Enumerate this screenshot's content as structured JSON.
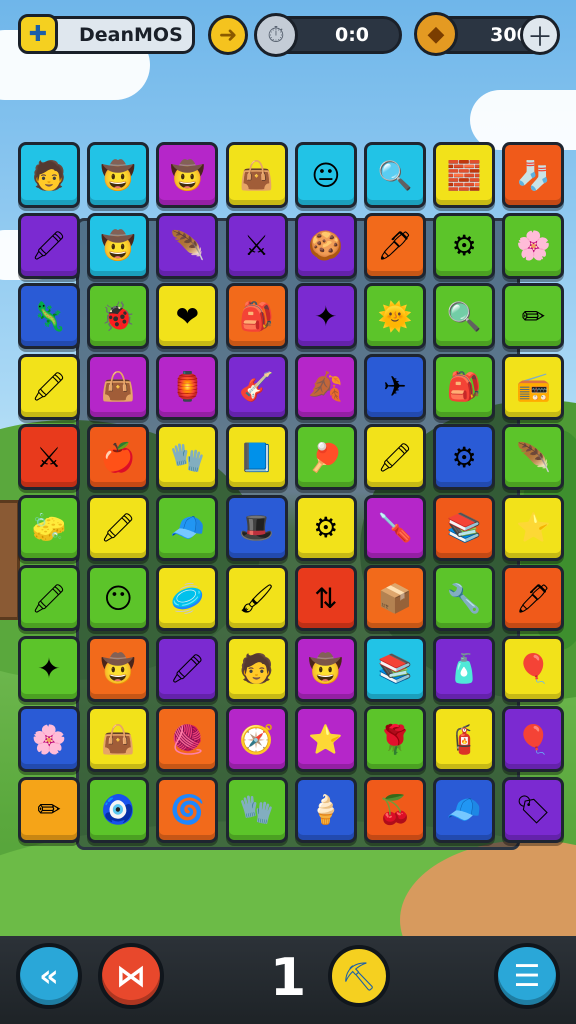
{
  "topbar": {
    "player_name": "DeanMOS",
    "timer": "0:0",
    "coins": "300",
    "name_icon": "puzzle-icon",
    "timer_lead_icon": "arrow-icon",
    "timer_icon": "stopwatch-icon",
    "coin_icon": "coin-icon",
    "plus_icon": "plus-icon"
  },
  "board": {
    "columns": 8,
    "rows": 10,
    "tiles": [
      [
        {
          "c": "#22c3e6",
          "i": "🧑"
        },
        {
          "c": "#22c3e6",
          "i": "🤠"
        },
        {
          "c": "#b526c9",
          "i": "🤠"
        },
        {
          "c": "#f2e21a",
          "i": "👜"
        },
        {
          "c": "#22c3e6",
          "i": "😐"
        },
        {
          "c": "#22c3e6",
          "i": "🔍"
        },
        {
          "c": "#f2e21a",
          "i": "🧱"
        },
        {
          "c": "#f05a1a",
          "i": "🧦"
        }
      ],
      [
        {
          "c": "#7b2ad1",
          "i": "🖍"
        },
        {
          "c": "#22c3e6",
          "i": "🤠"
        },
        {
          "c": "#7b2ad1",
          "i": "🪶"
        },
        {
          "c": "#7b2ad1",
          "i": "⚔"
        },
        {
          "c": "#7b2ad1",
          "i": "🍪"
        },
        {
          "c": "#f26a1b",
          "i": "🖊"
        },
        {
          "c": "#5cc42a",
          "i": "⚙"
        },
        {
          "c": "#5cc42a",
          "i": "🌸"
        }
      ],
      [
        {
          "c": "#2a5bd6",
          "i": "🦎"
        },
        {
          "c": "#5cc42a",
          "i": "🐞"
        },
        {
          "c": "#f2e21a",
          "i": "❤"
        },
        {
          "c": "#f26a1b",
          "i": "🎒"
        },
        {
          "c": "#7b2ad1",
          "i": "✦"
        },
        {
          "c": "#5cc42a",
          "i": "🌞"
        },
        {
          "c": "#5cc42a",
          "i": "🔍"
        },
        {
          "c": "#5cc42a",
          "i": "✏"
        }
      ],
      [
        {
          "c": "#f2e21a",
          "i": "🖍"
        },
        {
          "c": "#b526c9",
          "i": "👜"
        },
        {
          "c": "#b526c9",
          "i": "🏮"
        },
        {
          "c": "#7b2ad1",
          "i": "🎸"
        },
        {
          "c": "#b526c9",
          "i": "🍂"
        },
        {
          "c": "#2a5bd6",
          "i": "✈"
        },
        {
          "c": "#5cc42a",
          "i": "🎒"
        },
        {
          "c": "#f2e21a",
          "i": "📻"
        }
      ],
      [
        {
          "c": "#e83a1c",
          "i": "⚔"
        },
        {
          "c": "#f05a1a",
          "i": "🍎"
        },
        {
          "c": "#f2e21a",
          "i": "🧤"
        },
        {
          "c": "#f2e21a",
          "i": "📘"
        },
        {
          "c": "#5cc42a",
          "i": "🏓"
        },
        {
          "c": "#f2e21a",
          "i": "🖍"
        },
        {
          "c": "#2a5bd6",
          "i": "⚙"
        },
        {
          "c": "#5cc42a",
          "i": "🪶"
        }
      ],
      [
        {
          "c": "#5cc42a",
          "i": "🧽"
        },
        {
          "c": "#f2e21a",
          "i": "🖍"
        },
        {
          "c": "#5cc42a",
          "i": "🧢"
        },
        {
          "c": "#2a5bd6",
          "i": "🎩"
        },
        {
          "c": "#f2e21a",
          "i": "⚙"
        },
        {
          "c": "#b526c9",
          "i": "🪛"
        },
        {
          "c": "#f05a1a",
          "i": "📚"
        },
        {
          "c": "#f2e21a",
          "i": "⭐"
        }
      ],
      [
        {
          "c": "#5cc42a",
          "i": "🖍"
        },
        {
          "c": "#5cc42a",
          "i": "😶"
        },
        {
          "c": "#f2e21a",
          "i": "🥏"
        },
        {
          "c": "#f2e21a",
          "i": "🖌"
        },
        {
          "c": "#e83a1c",
          "i": "⇅"
        },
        {
          "c": "#f26a1b",
          "i": "📦"
        },
        {
          "c": "#5cc42a",
          "i": "🔧"
        },
        {
          "c": "#f05a1a",
          "i": "🖊"
        }
      ],
      [
        {
          "c": "#5cc42a",
          "i": "✦"
        },
        {
          "c": "#f26a1b",
          "i": "🤠"
        },
        {
          "c": "#7b2ad1",
          "i": "🖍"
        },
        {
          "c": "#f2e21a",
          "i": "🧑"
        },
        {
          "c": "#b526c9",
          "i": "🤠"
        },
        {
          "c": "#22c3e6",
          "i": "📚"
        },
        {
          "c": "#7b2ad1",
          "i": "🧴"
        },
        {
          "c": "#f2e21a",
          "i": "🎈"
        }
      ],
      [
        {
          "c": "#2a5bd6",
          "i": "🌸"
        },
        {
          "c": "#f2e21a",
          "i": "👜"
        },
        {
          "c": "#f26a1b",
          "i": "🧶"
        },
        {
          "c": "#b526c9",
          "i": "🧭"
        },
        {
          "c": "#b526c9",
          "i": "⭐"
        },
        {
          "c": "#5cc42a",
          "i": "🌹"
        },
        {
          "c": "#f2e21a",
          "i": "🧯"
        },
        {
          "c": "#7b2ad1",
          "i": "🎈"
        }
      ],
      [
        {
          "c": "#f5a418",
          "i": "✏"
        },
        {
          "c": "#5cc42a",
          "i": "🧿"
        },
        {
          "c": "#f26a1b",
          "i": "🌀"
        },
        {
          "c": "#5cc42a",
          "i": "🧤"
        },
        {
          "c": "#2a5bd6",
          "i": "🍦"
        },
        {
          "c": "#f05a1a",
          "i": "🍒"
        },
        {
          "c": "#2a5bd6",
          "i": "🧢"
        },
        {
          "c": "#7b2ad1",
          "i": "🏷"
        }
      ]
    ]
  },
  "bottombar": {
    "back_icon": "back-arrow-icon",
    "swap_icon": "swap-icon",
    "moves_count": "1",
    "hint_icon": "shovel-icon",
    "menu_icon": "menu-icon"
  }
}
